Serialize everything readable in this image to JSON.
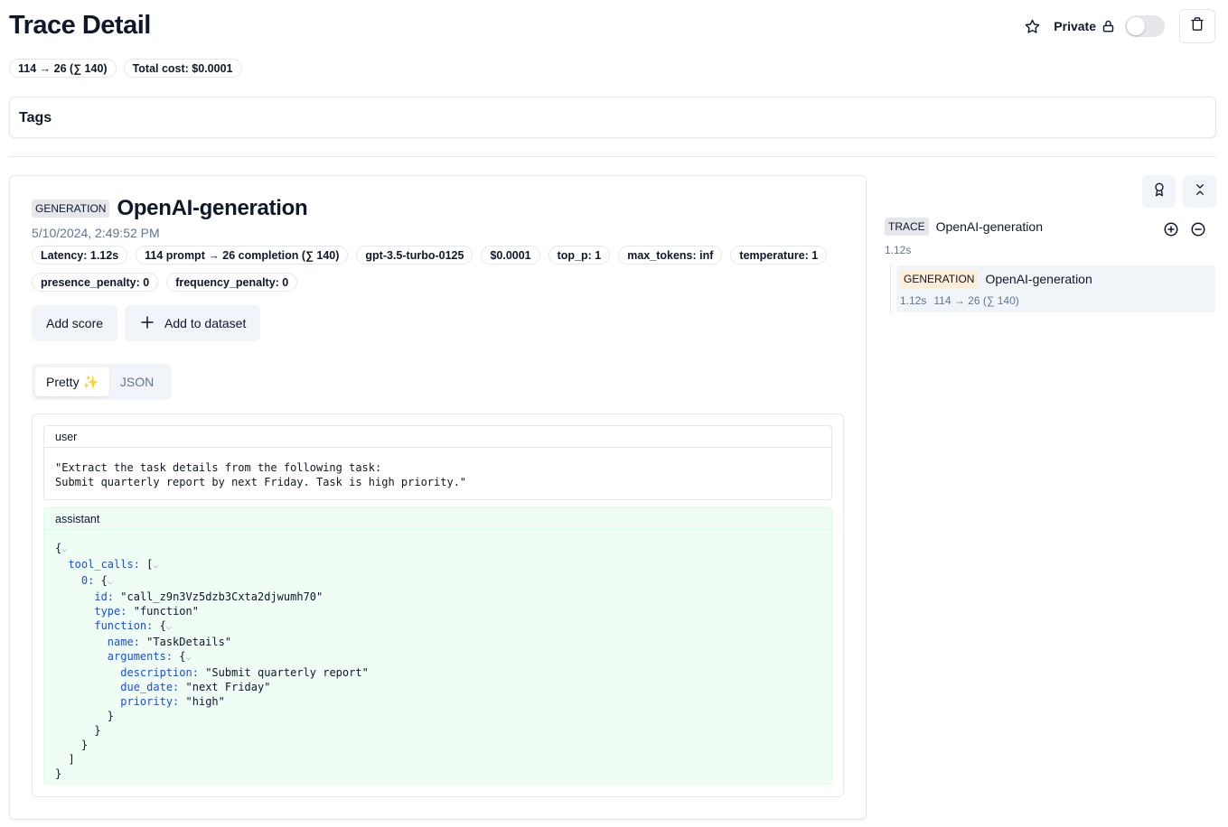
{
  "header": {
    "title": "Trace Detail",
    "private_label": "Private",
    "private_enabled": false
  },
  "summary_pills": [
    "114 → 26 (∑ 140)",
    "Total cost: $0.0001"
  ],
  "tags": {
    "title": "Tags"
  },
  "observation": {
    "type_badge": "GENERATION",
    "name": "OpenAI-generation",
    "timestamp": "5/10/2024, 2:49:52 PM",
    "pills": [
      "Latency: 1.12s",
      "114 prompt → 26 completion (∑ 140)",
      "gpt-3.5-turbo-0125",
      "$0.0001",
      "top_p: 1",
      "max_tokens: inf",
      "temperature: 1",
      "presence_penalty: 0",
      "frequency_penalty: 0"
    ],
    "buttons": {
      "add_score": "Add score",
      "add_to_dataset": "Add to dataset"
    },
    "tabs": {
      "pretty": "Pretty",
      "pretty_emoji": "✨",
      "json": "JSON",
      "active": "pretty"
    },
    "messages": {
      "user": {
        "role": "user",
        "content": "\"Extract the task details from the following task:\nSubmit quarterly report by next Friday. Task is high priority.\""
      },
      "assistant": {
        "role": "assistant",
        "tool_call_id": "\"call_z9n3Vz5dzb3Cxta2djwumh70\"",
        "tool_type": "\"function\"",
        "function_name": "\"TaskDetails\"",
        "description": "\"Submit quarterly report\"",
        "due_date": "\"next Friday\"",
        "priority": "\"high\""
      }
    }
  },
  "trace_tree": {
    "trace_badge": "TRACE",
    "trace_name": "OpenAI-generation",
    "trace_latency": "1.12s",
    "node": {
      "badge": "GENERATION",
      "name": "OpenAI-generation",
      "latency": "1.12s",
      "tokens": "114 → 26 (∑ 140)"
    }
  },
  "colors": {
    "accent_orange": "#ffedd5",
    "assistant_bg": "#f0fdf4",
    "json_key": "#1d4ed8"
  }
}
